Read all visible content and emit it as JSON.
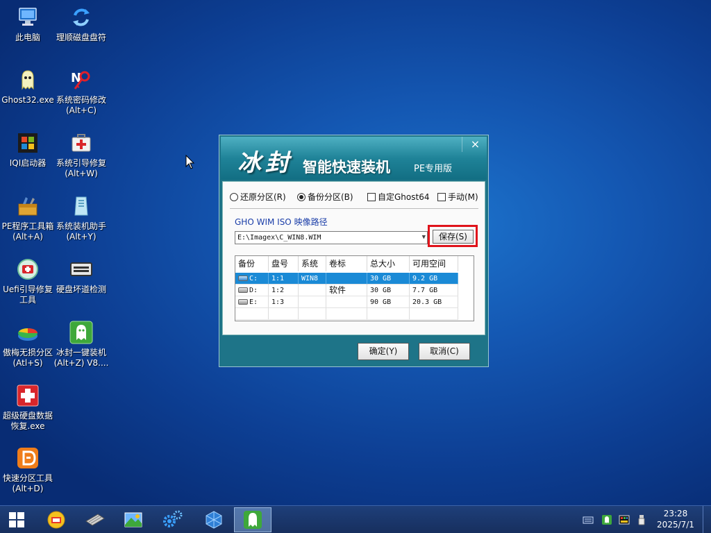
{
  "desktop": {
    "icons": [
      {
        "id": "this-pc",
        "label": "此电脑"
      },
      {
        "id": "disk-order",
        "label": "理顺磁盘盘符"
      },
      {
        "id": "ghost32",
        "label": "Ghost32.exe"
      },
      {
        "id": "password-edit",
        "label": "系统密码修改\n(Alt+C)"
      },
      {
        "id": "iqi-boot",
        "label": "IQI启动器"
      },
      {
        "id": "boot-repair",
        "label": "系统引导修复\n(Alt+W)"
      },
      {
        "id": "pe-toolbox",
        "label": "PE程序工具箱\n(Alt+A)"
      },
      {
        "id": "install-helper",
        "label": "系统装机助手\n(Alt+Y)"
      },
      {
        "id": "uefi-repair",
        "label": "Uefi引导修复\n工具"
      },
      {
        "id": "disk-badblock",
        "label": "硬盘坏道检测"
      },
      {
        "id": "aomei-partition",
        "label": "傲梅无损分区\n(Atl+S)"
      },
      {
        "id": "bingfeng-onekey",
        "label": "冰封一键装机\n(Alt+Z) V8...."
      },
      {
        "id": "data-recovery",
        "label": "超级硬盘数据\n恢复.exe"
      },
      {
        "id": "quick-partition",
        "label": "快速分区工具\n(Alt+D)"
      }
    ]
  },
  "dialog": {
    "brand": "冰封",
    "product": "智能快速装机",
    "edition": "PE专用版",
    "close_icon": "×",
    "options": {
      "restore": "还原分区(R)",
      "backup": "备份分区(B)",
      "custom_ghost": "自定Ghost64",
      "manual": "手动(M)",
      "selected": "backup"
    },
    "path_label": "GHO WIM ISO 映像路径",
    "path_value": "E:\\Imagex\\C_WIN8.WIM",
    "save_button": "保存(S)",
    "table": {
      "headers": [
        "备份",
        "盘号",
        "系统",
        "卷标",
        "总大小",
        "可用空间"
      ],
      "rows": [
        {
          "drive": "C:",
          "disk": "1:1",
          "system": "WIN8",
          "volume": "",
          "total": "30 GB",
          "free": "9.2 GB",
          "selected": true
        },
        {
          "drive": "D:",
          "disk": "1:2",
          "system": "",
          "volume": "软件",
          "total": "30 GB",
          "free": "7.7 GB",
          "selected": false
        },
        {
          "drive": "E:",
          "disk": "1:3",
          "system": "",
          "volume": "",
          "total": "90 GB",
          "free": "20.3 GB",
          "selected": false
        }
      ]
    },
    "ok_button": "确定(Y)",
    "cancel_button": "取消(C)"
  },
  "taskbar": {
    "clock_time": "23:28",
    "clock_date": "2025/7/1"
  },
  "colors": {
    "desktop_blue": "#1457b2",
    "dialog_teal": "#1e7488",
    "selection_blue": "#1a8ad6",
    "highlight_red": "#e0131b"
  }
}
